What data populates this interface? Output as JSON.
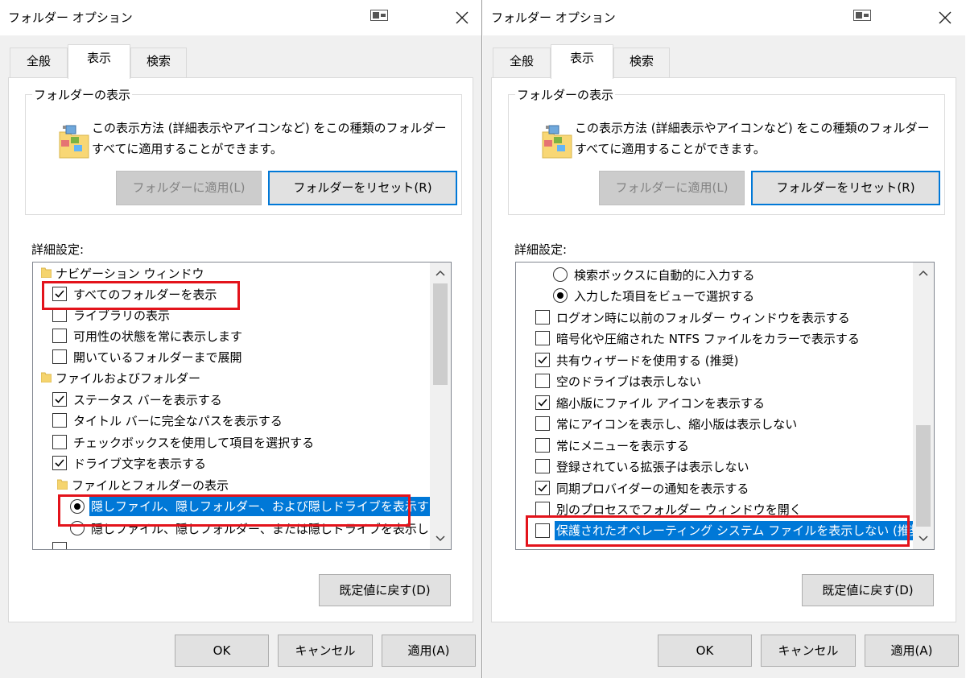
{
  "dialogs": [
    {
      "title": "フォルダー オプション",
      "tabs": [
        "全般",
        "表示",
        "検索"
      ],
      "folder_views": {
        "group_label": "フォルダーの表示",
        "description": "この表示方法 (詳細表示やアイコンなど) をこの種類のフォルダーすべてに適用することができます。",
        "apply_button": "フォルダーに適用(L)",
        "reset_button": "フォルダーをリセット(R)"
      },
      "advanced_label": "詳細設定:",
      "items": [
        {
          "type": "folder",
          "label": "ナビゲーション ウィンドウ"
        },
        {
          "type": "checkbox",
          "checked": true,
          "label": "すべてのフォルダーを表示"
        },
        {
          "type": "checkbox",
          "checked": false,
          "label": "ライブラリの表示"
        },
        {
          "type": "checkbox",
          "checked": false,
          "label": "可用性の状態を常に表示します"
        },
        {
          "type": "checkbox",
          "checked": false,
          "label": "開いているフォルダーまで展開"
        },
        {
          "type": "folder",
          "label": "ファイルおよびフォルダー"
        },
        {
          "type": "checkbox",
          "checked": true,
          "label": "ステータス バーを表示する"
        },
        {
          "type": "checkbox",
          "checked": false,
          "label": "タイトル バーに完全なパスを表示する"
        },
        {
          "type": "checkbox",
          "checked": false,
          "label": "チェックボックスを使用して項目を選択する"
        },
        {
          "type": "checkbox",
          "checked": true,
          "label": "ドライブ文字を表示する"
        },
        {
          "type": "folder",
          "label": "ファイルとフォルダーの表示"
        },
        {
          "type": "radio",
          "checked": true,
          "selected": true,
          "label": "隠しファイル、隠しフォルダー、および隠しドライブを表示する"
        },
        {
          "type": "radio",
          "checked": false,
          "label": "隠しファイル、隠しフォルダー、または隠しドライブを表示しない"
        }
      ],
      "defaults_button": "既定値に戻す(D)",
      "ok_button": "OK",
      "cancel_button": "キャンセル",
      "apply_button": "適用(A)"
    },
    {
      "title": "フォルダー オプション",
      "tabs": [
        "全般",
        "表示",
        "検索"
      ],
      "folder_views": {
        "group_label": "フォルダーの表示",
        "description": "この表示方法 (詳細表示やアイコンなど) をこの種類のフォルダーすべてに適用することができます。",
        "apply_button": "フォルダーに適用(L)",
        "reset_button": "フォルダーをリセット(R)"
      },
      "advanced_label": "詳細設定:",
      "items": [
        {
          "type": "radio",
          "checked": false,
          "label": "検索ボックスに自動的に入力する"
        },
        {
          "type": "radio",
          "checked": true,
          "label": "入力した項目をビューで選択する"
        },
        {
          "type": "checkbox",
          "checked": false,
          "label": "ログオン時に以前のフォルダー ウィンドウを表示する"
        },
        {
          "type": "checkbox",
          "checked": false,
          "label": "暗号化や圧縮された NTFS ファイルをカラーで表示する"
        },
        {
          "type": "checkbox",
          "checked": true,
          "label": "共有ウィザードを使用する (推奨)"
        },
        {
          "type": "checkbox",
          "checked": false,
          "label": "空のドライブは表示しない"
        },
        {
          "type": "checkbox",
          "checked": true,
          "label": "縮小版にファイル アイコンを表示する"
        },
        {
          "type": "checkbox",
          "checked": false,
          "label": "常にアイコンを表示し、縮小版は表示しない"
        },
        {
          "type": "checkbox",
          "checked": false,
          "label": "常にメニューを表示する"
        },
        {
          "type": "checkbox",
          "checked": false,
          "label": "登録されている拡張子は表示しない"
        },
        {
          "type": "checkbox",
          "checked": true,
          "label": "同期プロバイダーの通知を表示する"
        },
        {
          "type": "checkbox",
          "checked": false,
          "label": "別のプロセスでフォルダー ウィンドウを開く"
        },
        {
          "type": "checkbox",
          "checked": false,
          "selected": true,
          "label": "保護されたオペレーティング システム ファイルを表示しない (推奨)"
        }
      ],
      "defaults_button": "既定値に戻す(D)",
      "ok_button": "OK",
      "cancel_button": "キャンセル",
      "apply_button": "適用(A)"
    }
  ],
  "highlight_color": "#e3131b",
  "selection_color": "#0078d7",
  "icons": [
    "help-icon",
    "close-icon",
    "folder-icon",
    "checkbox-icon",
    "radio-icon",
    "chevron-up-icon",
    "chevron-down-icon"
  ]
}
